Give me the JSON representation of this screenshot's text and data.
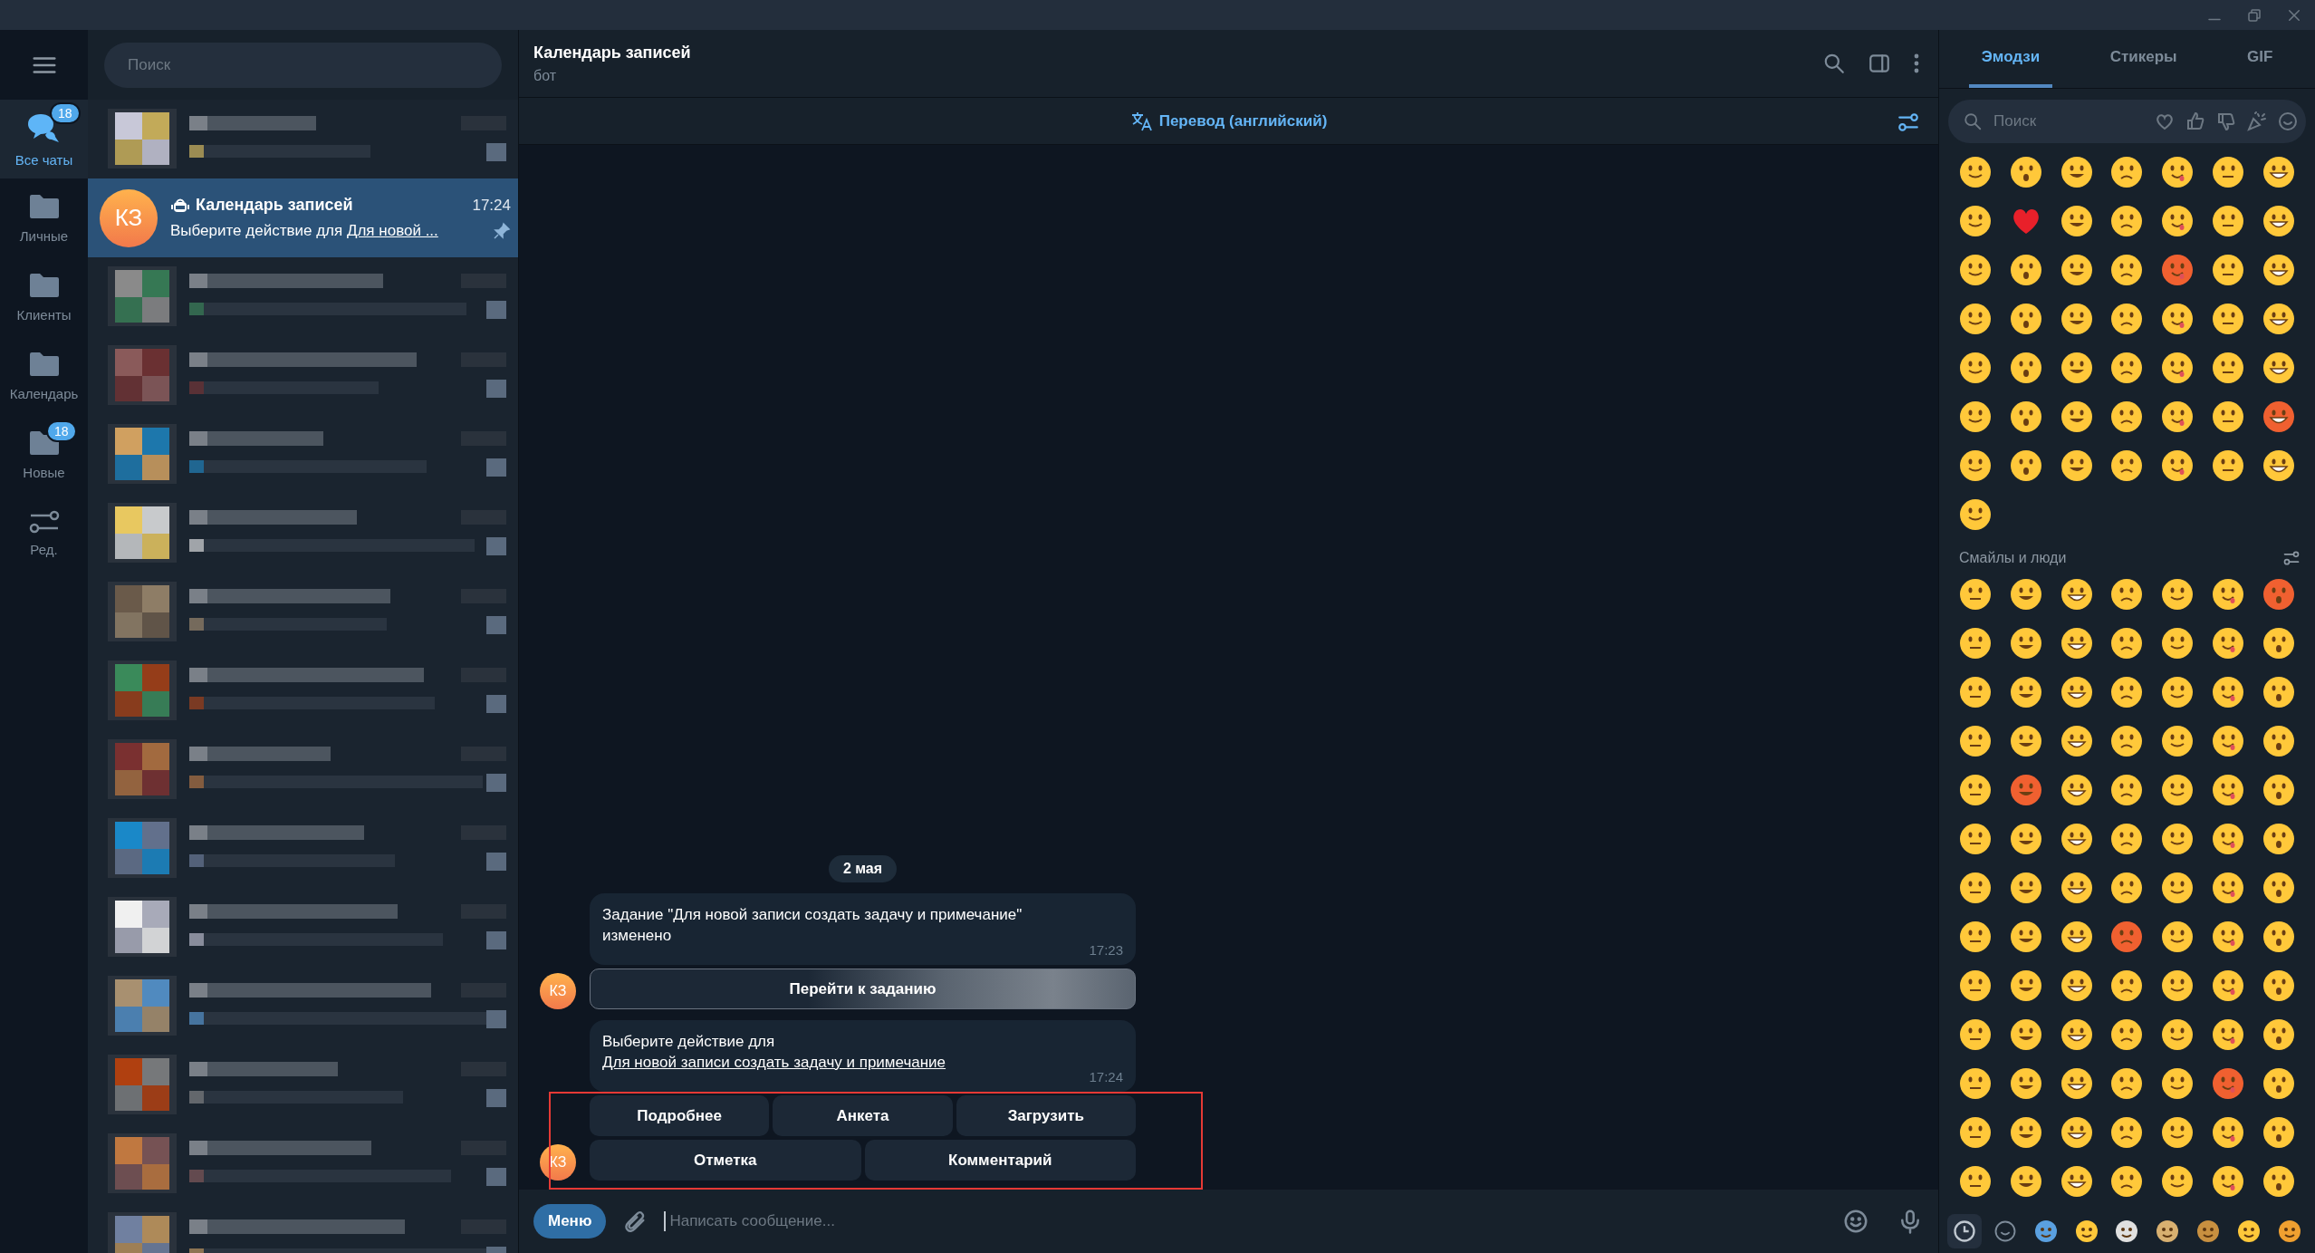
{
  "folders": [
    {
      "kind": "all",
      "label": "Все чаты",
      "badge": "18",
      "selected": true
    },
    {
      "kind": "folder",
      "label": "Личные",
      "selected": false
    },
    {
      "kind": "folder",
      "label": "Клиенты",
      "selected": false
    },
    {
      "kind": "folder",
      "label": "Календарь",
      "selected": false
    },
    {
      "kind": "folder",
      "label": "Новые",
      "badge": "18",
      "selected": false
    },
    {
      "kind": "edit",
      "label": "Ред.",
      "selected": false
    }
  ],
  "chat_search": {
    "placeholder": "Поиск"
  },
  "chats": [
    {
      "kind": "hidden",
      "selected": false
    },
    {
      "kind": "chat",
      "avatar": "КЗ",
      "name": "Календарь записей",
      "time": "17:24",
      "preview": "Выберите действие для ",
      "preview_link": "Для новой ...",
      "pinned": true,
      "selected": true
    },
    {
      "kind": "hidden",
      "selected": false
    },
    {
      "kind": "hidden",
      "selected": false
    },
    {
      "kind": "hidden",
      "selected": false
    },
    {
      "kind": "hidden",
      "selected": false
    },
    {
      "kind": "hidden",
      "selected": false
    },
    {
      "kind": "hidden",
      "selected": false
    },
    {
      "kind": "hidden",
      "selected": false
    },
    {
      "kind": "hidden",
      "selected": false
    },
    {
      "kind": "hidden",
      "selected": false
    },
    {
      "kind": "hidden",
      "selected": false
    },
    {
      "kind": "hidden",
      "selected": false
    },
    {
      "kind": "hidden",
      "selected": false
    },
    {
      "kind": "hidden",
      "selected": false
    }
  ],
  "chat_header": {
    "title": "Календарь записей",
    "subtitle": "бот"
  },
  "translate_bar": {
    "label": "Перевод (английский)"
  },
  "messages": {
    "date": "2 мая",
    "items": [
      {
        "avatar": "КЗ",
        "text": "Задание \"Для новой записи создать задачу и примечание\" изменено",
        "time": "17:23",
        "highlighted": false,
        "keyboard": [
          [
            {
              "label": "Перейти к заданию",
              "loading": true
            }
          ]
        ]
      },
      {
        "avatar": "КЗ",
        "text": "Выберите действие для ",
        "link": "Для новой записи создать задачу и примечание",
        "time": "17:24",
        "highlighted": true,
        "keyboard": [
          [
            {
              "label": "Подробнее",
              "loading": false
            },
            {
              "label": "Анкета",
              "loading": false
            },
            {
              "label": "Загрузить",
              "loading": false
            }
          ],
          [
            {
              "label": "Отметка",
              "loading": false
            },
            {
              "label": "Комментарий",
              "loading": false
            }
          ]
        ]
      }
    ]
  },
  "composer": {
    "menu_button": "Меню",
    "placeholder": "Написать сообщение..."
  },
  "emoji_panel": {
    "tabs": [
      {
        "label": "Эмодзи",
        "selected": true
      },
      {
        "label": "Стикеры",
        "selected": false
      },
      {
        "label": "GIF",
        "selected": false
      }
    ],
    "search": {
      "placeholder": "Поиск"
    },
    "section_title": "Смайлы и люди",
    "categories": [
      {
        "kind": "recent",
        "selected": true
      },
      {
        "kind": "smileys",
        "selected": false
      }
    ]
  }
}
